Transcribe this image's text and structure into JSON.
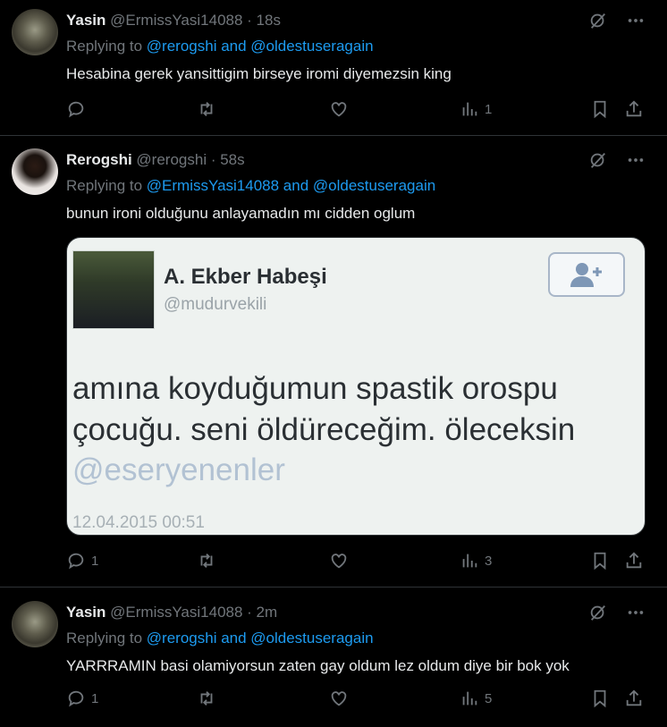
{
  "tweets": [
    {
      "name": "Yasin",
      "handle": "@ErmissYasi14088",
      "time": "· 18s",
      "replying_prefix": "Replying to",
      "replying_to": "@rerogshi and @oldestuseragain",
      "text": "Hesabina gerek yansittigim birseye iromi diyemezsin king",
      "replies": "",
      "views": "1"
    },
    {
      "name": "Rerogshi",
      "handle": "@rerogshi",
      "time": "· 58s",
      "replying_prefix": "Replying to",
      "replying_to": "@ErmissYasi14088 and @oldestuseragain",
      "text": "bunun ironi olduğunu anlayamadın mı cidden oglum",
      "replies": "1",
      "views": "3",
      "embed": {
        "name": "A. Ekber Habeşi",
        "handle": "@mudurvekili",
        "body_line1": "amına koyduğumun spastik orospu",
        "body_line2": "çocuğu. seni öldüreceğim. öleceksin",
        "mention": "@eseryenenler",
        "date": "12.04.2015 00:51"
      }
    },
    {
      "name": "Yasin",
      "handle": "@ErmissYasi14088",
      "time": "· 2m",
      "replying_prefix": "Replying to",
      "replying_to": "@rerogshi and @oldestuseragain",
      "text": "YARRRAMIN basi olamiyorsun zaten  gay oldum lez oldum diye bir bok yok",
      "replies": "1",
      "views": "5"
    }
  ],
  "icons": {
    "grok": "grok-icon",
    "more": "more-icon",
    "reply": "reply-icon",
    "retweet": "retweet-icon",
    "like": "like-icon",
    "views": "views-icon",
    "bookmark": "bookmark-icon",
    "share": "share-icon"
  },
  "colors": {
    "background": "#000000",
    "text": "#e7e9ea",
    "muted": "#71767b",
    "link": "#1d9bf0",
    "divider": "#2f3336"
  }
}
